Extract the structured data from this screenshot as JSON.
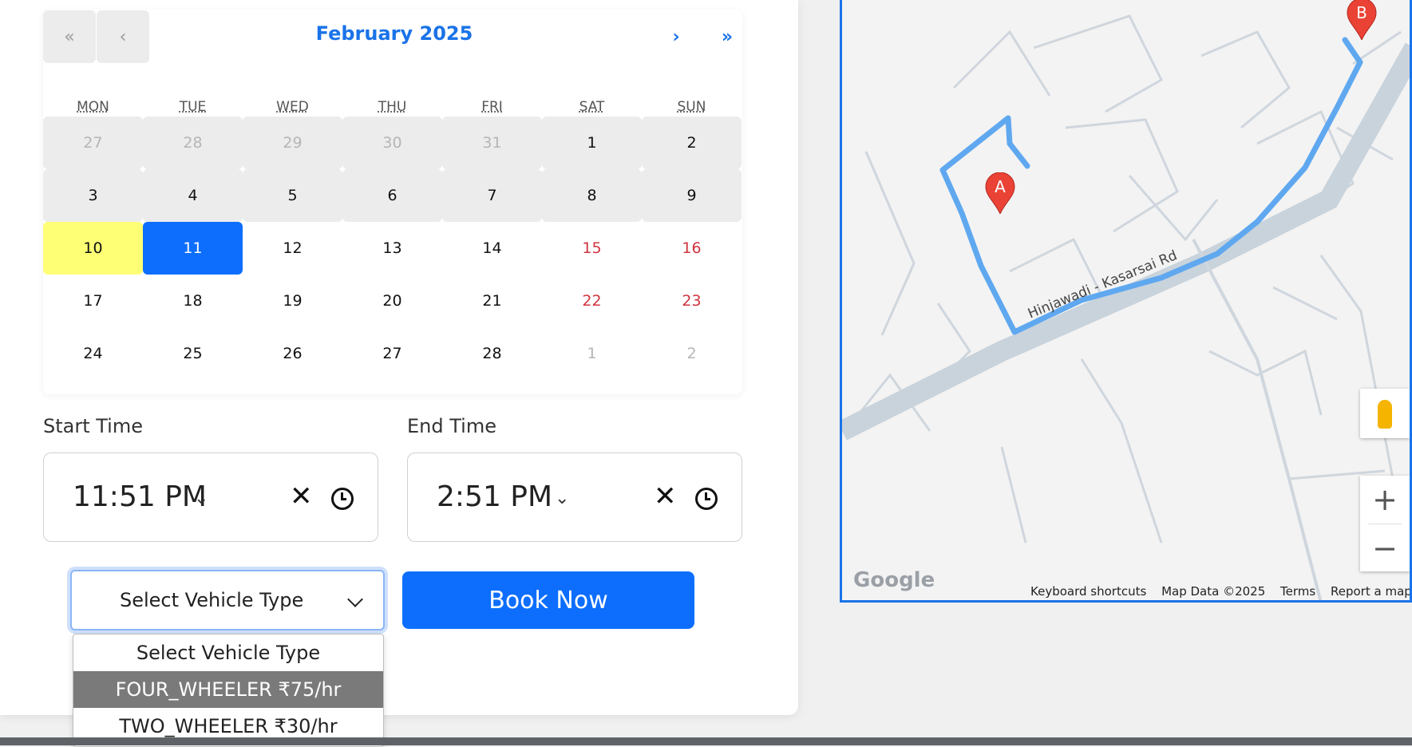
{
  "calendar": {
    "nav": {
      "prev_year": "«",
      "prev_month": "‹",
      "next_month": "›",
      "next_year": "»"
    },
    "month_label": "February 2025",
    "weekdays": [
      "MON",
      "TUE",
      "WED",
      "THU",
      "FRI",
      "SAT",
      "SUN"
    ],
    "weeks": [
      [
        {
          "d": "27",
          "s": "neighbor disabled"
        },
        {
          "d": "28",
          "s": "neighbor disabled"
        },
        {
          "d": "29",
          "s": "neighbor disabled"
        },
        {
          "d": "30",
          "s": "neighbor disabled"
        },
        {
          "d": "31",
          "s": "neighbor disabled"
        },
        {
          "d": "1",
          "s": "disabled"
        },
        {
          "d": "2",
          "s": "disabled"
        }
      ],
      [
        {
          "d": "3",
          "s": "disabled"
        },
        {
          "d": "4",
          "s": "disabled"
        },
        {
          "d": "5",
          "s": "disabled"
        },
        {
          "d": "6",
          "s": "disabled"
        },
        {
          "d": "7",
          "s": "disabled"
        },
        {
          "d": "8",
          "s": "disabled"
        },
        {
          "d": "9",
          "s": "disabled"
        }
      ],
      [
        {
          "d": "10",
          "s": "today"
        },
        {
          "d": "11",
          "s": "selected"
        },
        {
          "d": "12",
          "s": ""
        },
        {
          "d": "13",
          "s": ""
        },
        {
          "d": "14",
          "s": ""
        },
        {
          "d": "15",
          "s": "weekend"
        },
        {
          "d": "16",
          "s": "weekend"
        }
      ],
      [
        {
          "d": "17",
          "s": ""
        },
        {
          "d": "18",
          "s": ""
        },
        {
          "d": "19",
          "s": ""
        },
        {
          "d": "20",
          "s": ""
        },
        {
          "d": "21",
          "s": ""
        },
        {
          "d": "22",
          "s": "weekend"
        },
        {
          "d": "23",
          "s": "weekend"
        }
      ],
      [
        {
          "d": "24",
          "s": ""
        },
        {
          "d": "25",
          "s": ""
        },
        {
          "d": "26",
          "s": ""
        },
        {
          "d": "27",
          "s": ""
        },
        {
          "d": "28",
          "s": ""
        },
        {
          "d": "1",
          "s": "neighbor"
        },
        {
          "d": "2",
          "s": "neighbor"
        }
      ]
    ]
  },
  "start_time": {
    "label": "Start Time",
    "value": "11:51  PM"
  },
  "end_time": {
    "label": "End Time",
    "value": "2:51  PM"
  },
  "vehicle_select": {
    "value": "Select Vehicle Type",
    "options": [
      "Select Vehicle Type",
      "FOUR_WHEELER ₹75/hr",
      "TWO_WHEELER ₹30/hr"
    ],
    "highlighted_index": 1
  },
  "book_button": "Book Now",
  "map": {
    "marker_a": "A",
    "marker_b": "B",
    "road_label": "Hinjawadi - Kasarsai Rd",
    "logo": "Google",
    "attribution": [
      "Keyboard shortcuts",
      "Map Data ©2025",
      "Terms",
      "Report a map error"
    ],
    "zoom_in": "+",
    "zoom_out": "−",
    "route_color": "#5fa8f0",
    "marker_color": "#ea4335"
  }
}
